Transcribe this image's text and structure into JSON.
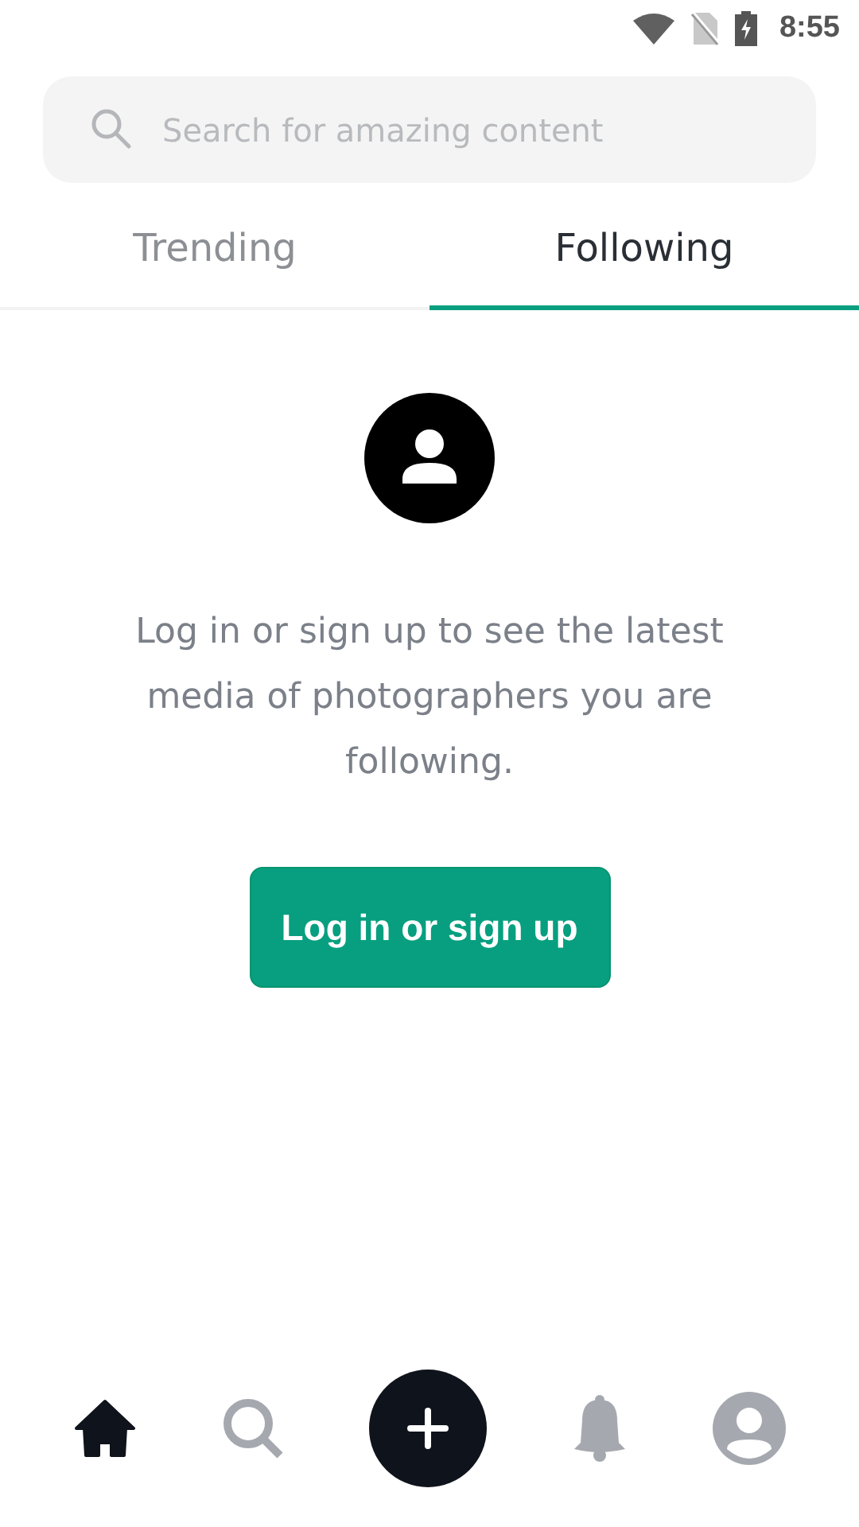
{
  "status_bar": {
    "time": "8:55"
  },
  "search": {
    "placeholder": "Search for amazing content"
  },
  "tabs": [
    {
      "label": "Trending",
      "selected": false
    },
    {
      "label": "Following",
      "selected": true
    }
  ],
  "empty_state": {
    "message": "Log in or sign up to see the latest media of photographers you are following.",
    "button": "Log in or sign up"
  },
  "bottom_nav": [
    {
      "kind": "home",
      "selected": true
    },
    {
      "kind": "search",
      "selected": false
    },
    {
      "kind": "add",
      "selected": false
    },
    {
      "kind": "bell",
      "selected": false
    },
    {
      "kind": "profile",
      "selected": false
    }
  ]
}
